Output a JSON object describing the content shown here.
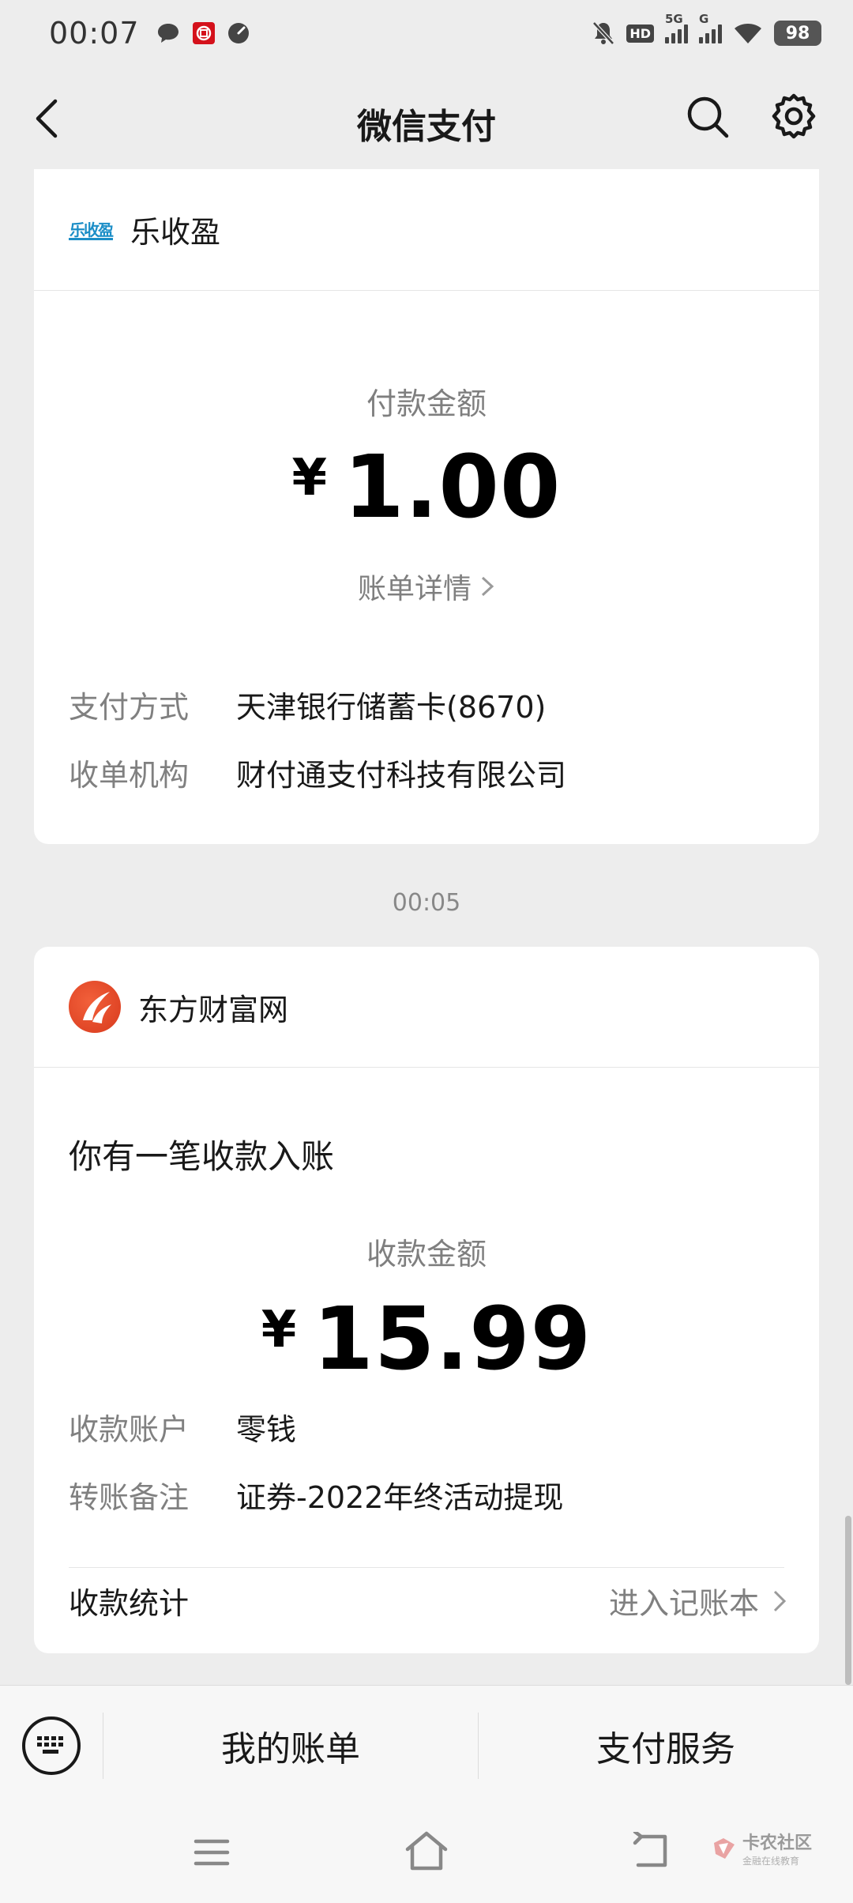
{
  "status_bar": {
    "time": "00:07",
    "left_icons": [
      "chat-bubble-icon",
      "bank-app-icon",
      "gauge-icon"
    ],
    "right_icons": [
      "bell-muted-icon",
      "hd-icon",
      "signal-5g-icon",
      "signal-g-icon",
      "wifi-icon"
    ],
    "hd_label": "HD",
    "net1": "5G",
    "net2": "G",
    "battery": "98"
  },
  "navbar": {
    "title": "微信支付"
  },
  "card1": {
    "merchant": "乐收盈",
    "logo_text": "乐收盈",
    "amount_label": "付款金额",
    "currency": "¥",
    "amount": "1.00",
    "detail_link": "账单详情",
    "rows": [
      {
        "key": "支付方式",
        "value": "天津银行储蓄卡(8670)"
      },
      {
        "key": "收单机构",
        "value": "财付通支付科技有限公司"
      }
    ]
  },
  "timestamp": "00:05",
  "card2": {
    "merchant": "东方财富网",
    "notice": "你有一笔收款入账",
    "amount_label": "收款金额",
    "currency": "¥",
    "amount": "15.99",
    "rows": [
      {
        "key": "收款账户",
        "value": "零钱"
      },
      {
        "key": "转账备注",
        "value": "证券-2022年终活动提现"
      }
    ],
    "stats_label": "收款统计",
    "stats_link": "进入记账本"
  },
  "bottom_bar": {
    "left": "我的账单",
    "right": "支付服务"
  },
  "watermark": {
    "main": "卡农社区",
    "sub": "金融在线教育"
  }
}
